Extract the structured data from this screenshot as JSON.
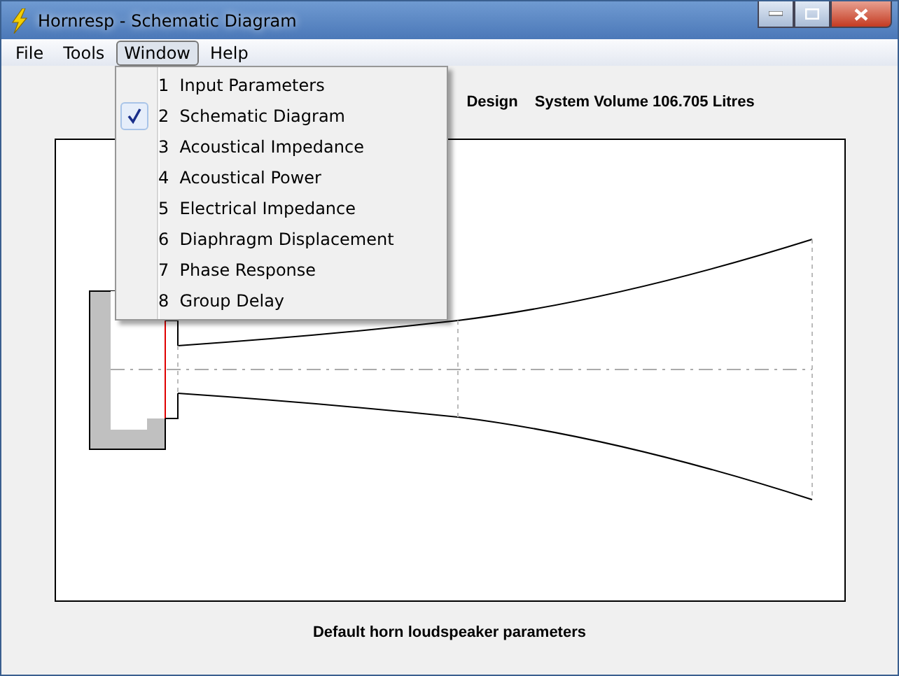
{
  "window": {
    "title": "Hornresp - Schematic Diagram"
  },
  "menu_bar": [
    {
      "label": "File",
      "selected": false
    },
    {
      "label": "Tools",
      "selected": false
    },
    {
      "label": "Window",
      "selected": true
    },
    {
      "label": "Help",
      "selected": false
    }
  ],
  "window_menu": [
    {
      "label": "1  Input Parameters",
      "checked": false
    },
    {
      "label": "2  Schematic Diagram",
      "checked": true
    },
    {
      "label": "3  Acoustical Impedance",
      "checked": false
    },
    {
      "label": "4  Acoustical Power",
      "checked": false
    },
    {
      "label": "5  Electrical Impedance",
      "checked": false
    },
    {
      "label": "6  Diaphragm Displacement",
      "checked": false
    },
    {
      "label": "7  Phase Response",
      "checked": false
    },
    {
      "label": "8  Group Delay",
      "checked": false
    }
  ],
  "header": [
    "Design",
    "System Volume 106.705 Litres"
  ],
  "caption": "Default horn loudspeaker parameters"
}
